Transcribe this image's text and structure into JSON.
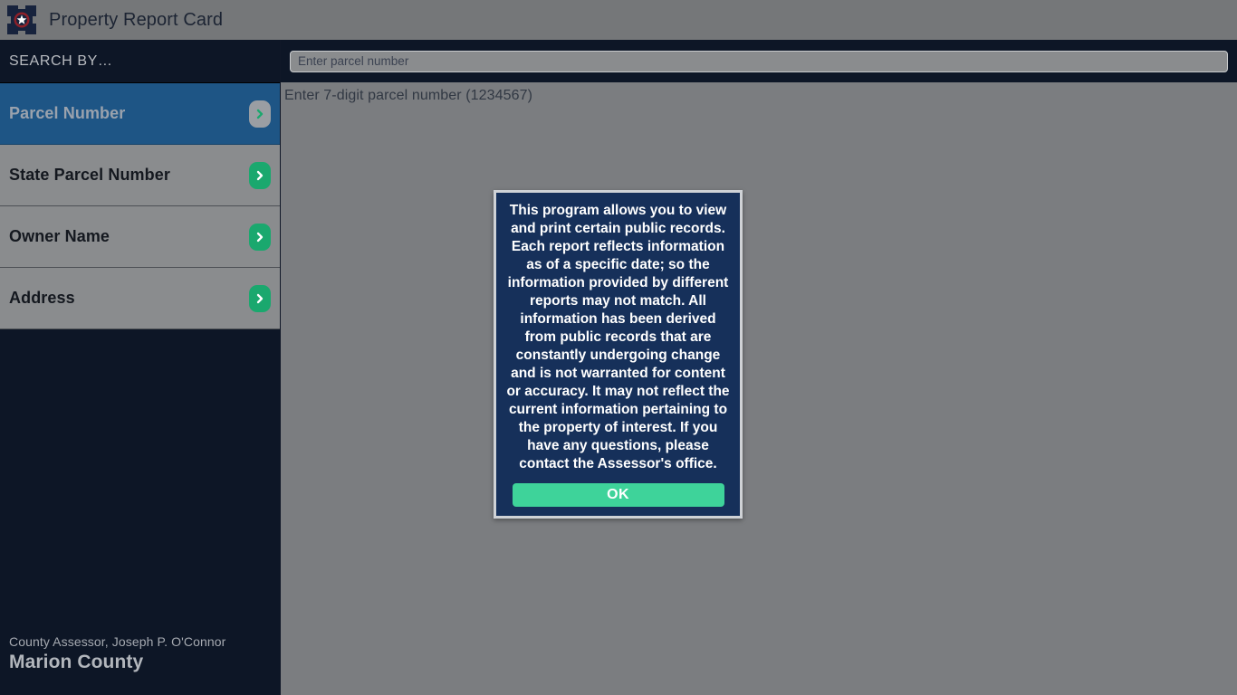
{
  "header": {
    "title": "Property Report Card",
    "logo_icon": "county-seal-star-icon"
  },
  "search": {
    "placeholder": "Enter parcel number",
    "value": "",
    "hint": "Enter 7-digit parcel number (1234567)"
  },
  "sidebar": {
    "header_label": "SEARCH BY…",
    "items": [
      {
        "label": "Parcel Number",
        "selected": true,
        "chevron_icon": "chevron-right-icon"
      },
      {
        "label": "State Parcel Number",
        "selected": false,
        "chevron_icon": "chevron-right-icon"
      },
      {
        "label": "Owner Name",
        "selected": false,
        "chevron_icon": "chevron-right-icon"
      },
      {
        "label": "Address",
        "selected": false,
        "chevron_icon": "chevron-right-icon"
      }
    ],
    "footer": {
      "assessor": "County Assessor, Joseph P. O'Connor",
      "county": "Marion County"
    }
  },
  "modal": {
    "message": "This program allows you to view and print certain public records. Each report reflects information as of a specific date; so the information provided by different reports may not match. All information has been derived from public records that are constantly undergoing change and is not warranted for content or accuracy. It may not reflect the current information pertaining to the property of interest. If you have any questions, please contact the Assessor's office.",
    "ok_label": "OK"
  },
  "colors": {
    "app_background": "#7b7d80",
    "header_bar": "#757779",
    "navy": "#0d1626",
    "modal_navy": "#16305a",
    "selected_blue": "#1e5585",
    "accent_green": "#1aa86e",
    "ok_green": "#3ed39a",
    "row_gray": "#8a8c8e"
  }
}
